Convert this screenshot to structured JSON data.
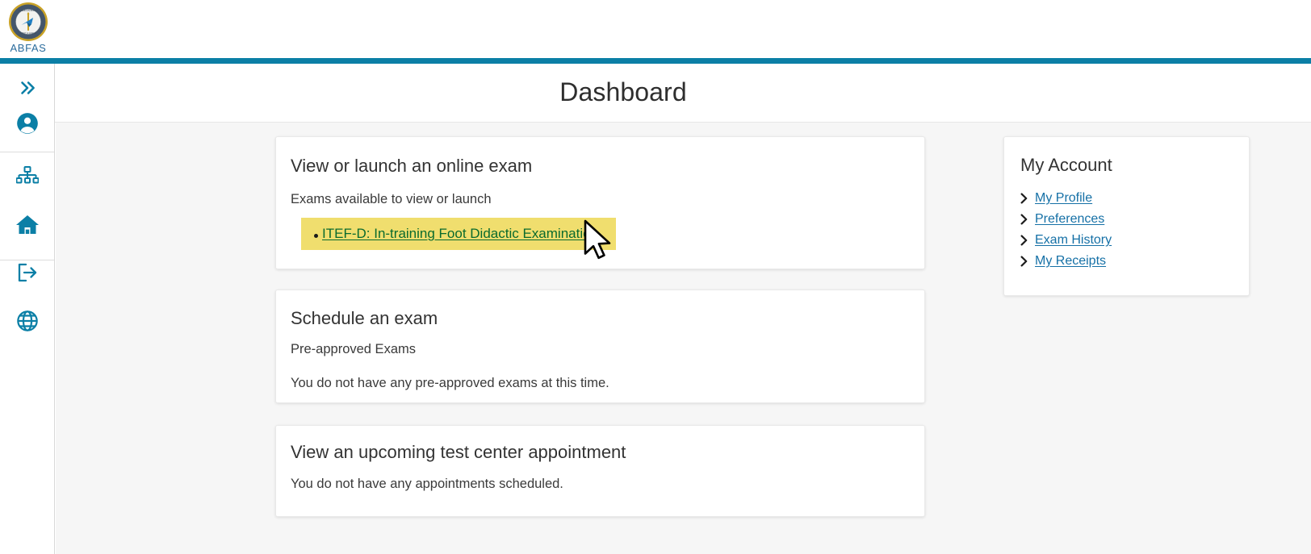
{
  "brand": {
    "wordmark": "ABFAS",
    "seal_alt": "abfas-seal"
  },
  "header": {
    "title": "Dashboard"
  },
  "sidebar": {
    "items": [
      {
        "name": "expand-menu",
        "icon": "chevron-double-right-icon"
      },
      {
        "name": "account",
        "icon": "user-circle-icon"
      },
      {
        "name": "organization",
        "icon": "sitemap-icon"
      },
      {
        "name": "home",
        "icon": "home-icon"
      },
      {
        "name": "logout",
        "icon": "sign-out-icon"
      },
      {
        "name": "language",
        "icon": "globe-icon"
      }
    ]
  },
  "main": {
    "cards": {
      "online_exam": {
        "heading": "View or launch an online exam",
        "subheading": "Exams available to view or launch",
        "exams": [
          {
            "label": "ITEF-D: In-training Foot Didactic Examination",
            "highlighted": true
          }
        ]
      },
      "schedule_exam": {
        "heading": "Schedule an exam",
        "subheading": "Pre-approved Exams",
        "message": "You do not have any pre-approved exams at this time."
      },
      "appointment": {
        "heading": "View an upcoming test center appointment",
        "message": "You do not have any appointments scheduled."
      }
    }
  },
  "side_panel": {
    "heading": "My Account",
    "links": [
      {
        "label": "My Profile"
      },
      {
        "label": "Preferences"
      },
      {
        "label": "Exam History"
      },
      {
        "label": "My Receipts"
      }
    ]
  },
  "colors": {
    "brand_teal": "#0b7fa6",
    "icon_teal": "#0b7fa6",
    "highlight_yellow": "#f0de6e",
    "exam_link_green": "#0a6b2e",
    "account_link_blue": "#1570a6",
    "canvas_gray": "#f6f6f6"
  }
}
